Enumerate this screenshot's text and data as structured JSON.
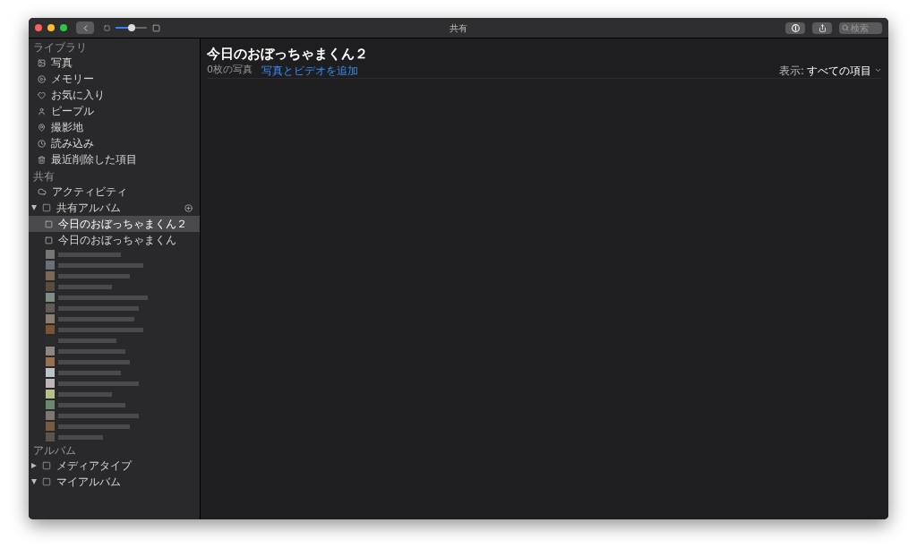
{
  "window": {
    "title": "共有"
  },
  "toolbar": {
    "zoom_slider": {
      "level": 0.5
    },
    "search": {
      "placeholder": "検索"
    }
  },
  "sidebar": {
    "library": {
      "heading": "ライブラリ",
      "items": [
        {
          "label": "写真",
          "selected": false
        },
        {
          "label": "メモリー",
          "selected": false
        },
        {
          "label": "お気に入り",
          "selected": false
        },
        {
          "label": "ピープル",
          "selected": false
        },
        {
          "label": "撮影地",
          "selected": false
        },
        {
          "label": "読み込み",
          "selected": false
        },
        {
          "label": "最近削除した項目",
          "selected": false
        }
      ]
    },
    "shared": {
      "heading": "共有",
      "activity": {
        "label": "アクティビティ",
        "selected": false
      },
      "shared_albums": {
        "label": "共有アルバム",
        "expanded": true,
        "children": [
          {
            "label": "今日のおぼっちゃまくん２",
            "selected": true
          },
          {
            "label": "今日のおぼっちゃまくん",
            "selected": false
          }
        ]
      }
    },
    "albums": {
      "heading": "アルバム",
      "groups": [
        {
          "label": "メディアタイプ",
          "expanded": false
        },
        {
          "label": "マイアルバム",
          "expanded": true
        }
      ]
    }
  },
  "content": {
    "title": "今日のおぼっちゃまくん２",
    "count": "0枚の写真",
    "add_link": "写真とビデオを追加",
    "filter_label": "表示:",
    "filter_value": "すべての項目"
  }
}
